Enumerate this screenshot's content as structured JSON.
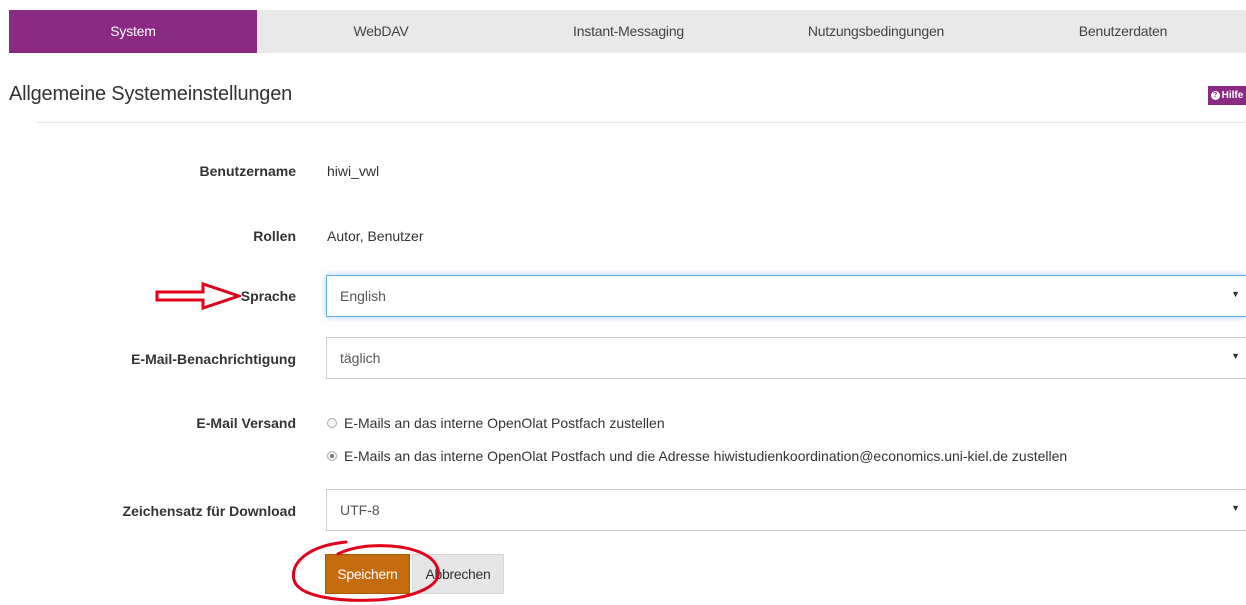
{
  "tabs": [
    {
      "label": "System",
      "active": true
    },
    {
      "label": "WebDAV",
      "active": false
    },
    {
      "label": "Instant-Messaging",
      "active": false
    },
    {
      "label": "Nutzungsbedingungen",
      "active": false
    },
    {
      "label": "Benutzerdaten",
      "active": false
    }
  ],
  "header": {
    "title": "Allgemeine Systemeinstellungen",
    "help_label": "Hilfe"
  },
  "form": {
    "username_label": "Benutzername",
    "username_value": "hiwi_vwl",
    "roles_label": "Rollen",
    "roles_value": "Autor, Benutzer",
    "language_label": "Sprache",
    "language_value": "English",
    "notification_label": "E-Mail-Benachrichtigung",
    "notification_value": "täglich",
    "mail_delivery_label": "E-Mail Versand",
    "mail_options": [
      {
        "label": "E-Mails an das interne OpenOlat Postfach zustellen",
        "checked": false
      },
      {
        "label": "E-Mails an das interne OpenOlat Postfach und die Adresse hiwistudienkoordination@economics.uni-kiel.de zustellen",
        "checked": true
      }
    ],
    "charset_label": "Zeichensatz für Download",
    "charset_value": "UTF-8"
  },
  "buttons": {
    "save_label": "Speichern",
    "cancel_label": "Abbrechen"
  },
  "colors": {
    "brand": "#8b2a82",
    "save_button": "#c46c0e",
    "annotation": "#e0001b"
  }
}
